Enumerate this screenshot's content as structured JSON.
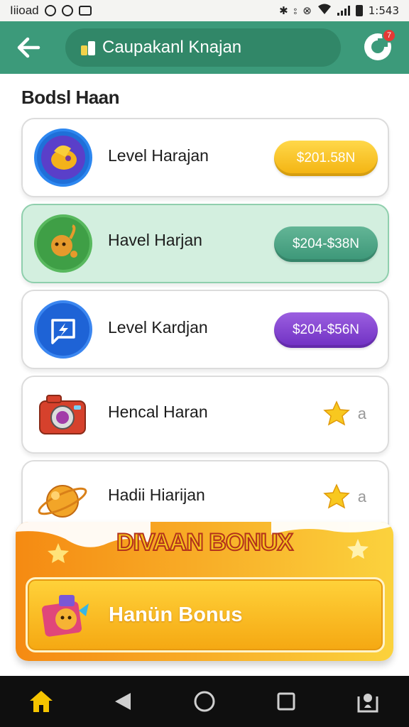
{
  "status_bar": {
    "carrier": "Iiioad",
    "time": "1:543"
  },
  "app_bar": {
    "title": "Caupakanl Knajan",
    "notification_count": "7"
  },
  "section": {
    "title": "Bodsl Haan"
  },
  "items": [
    {
      "label": "Level Harajan",
      "reward": "$201.58N",
      "reward_color": "#f3b20f",
      "icon": "dragon-icon"
    },
    {
      "label": "Havel Harjan",
      "reward": "$204-$38N",
      "reward_color": "#3b9677",
      "icon": "monkey-icon"
    },
    {
      "label": "Level Kardjan",
      "reward": "$204-$56N",
      "reward_color": "#6f2fc2",
      "icon": "lightning-badge-icon"
    },
    {
      "label": "Hencal Haran",
      "extra": "a",
      "icon": "camera-icon"
    },
    {
      "label": "Hadii Hiarijan",
      "extra": "a",
      "icon": "planet-icon"
    }
  ],
  "bonus": {
    "title": "DIVAAN BONUX",
    "button_label": "Hanün Bonus"
  },
  "colors": {
    "primary": "#3c9a7a",
    "highlight": "#d3efdf",
    "accent_gold": "#f3b20f",
    "accent_purple": "#6f2fc2",
    "nav_bg": "#0f0f0f",
    "home_active": "#f5c400"
  }
}
